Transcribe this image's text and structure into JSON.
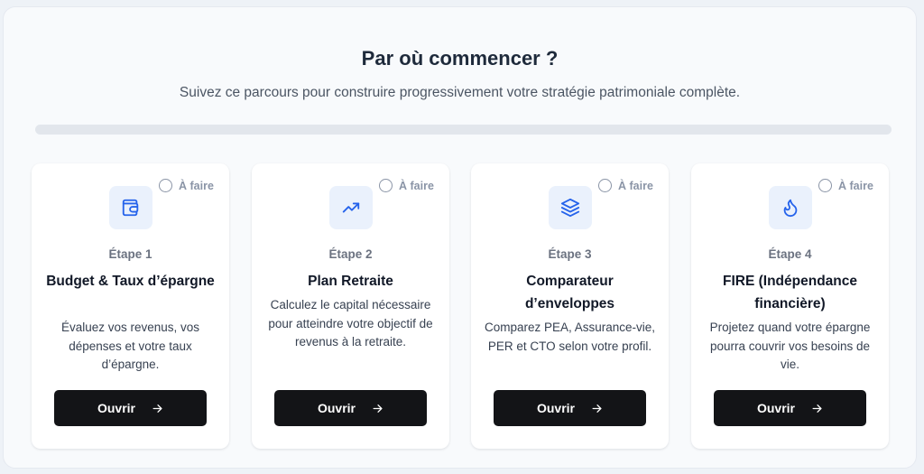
{
  "header": {
    "title": "Par où commencer ?",
    "subtitle": "Suivez ce parcours pour construire progressivement votre stratégie patrimoniale complète."
  },
  "progress": {
    "value": 0
  },
  "colors": {
    "accent": "#2563eb",
    "button_bg": "#131417",
    "icon_bg": "#eaf1fc",
    "status_gray": "#8a94a6"
  },
  "cards": [
    {
      "status": "À faire",
      "icon": "wallet-icon",
      "step": "Étape 1",
      "title": "Budget & Taux d’épargne",
      "description": "Évaluez vos revenus, vos dépenses et votre taux d’épargne.",
      "button_label": "Ouvrir"
    },
    {
      "status": "À faire",
      "icon": "trending-up-icon",
      "step": "Étape 2",
      "title": "Plan Retraite",
      "description": "Calculez le capital nécessaire pour atteindre votre objectif de revenus à la retraite.",
      "button_label": "Ouvrir"
    },
    {
      "status": "À faire",
      "icon": "layers-icon",
      "step": "Étape 3",
      "title": "Comparateur d’enveloppes",
      "description": "Comparez PEA, Assurance-vie, PER et CTO selon votre profil.",
      "button_label": "Ouvrir"
    },
    {
      "status": "À faire",
      "icon": "flame-icon",
      "step": "Étape 4",
      "title": "FIRE (Indépendance financière)",
      "description": "Projetez quand votre épargne pourra couvrir vos besoins de vie.",
      "button_label": "Ouvrir"
    }
  ]
}
